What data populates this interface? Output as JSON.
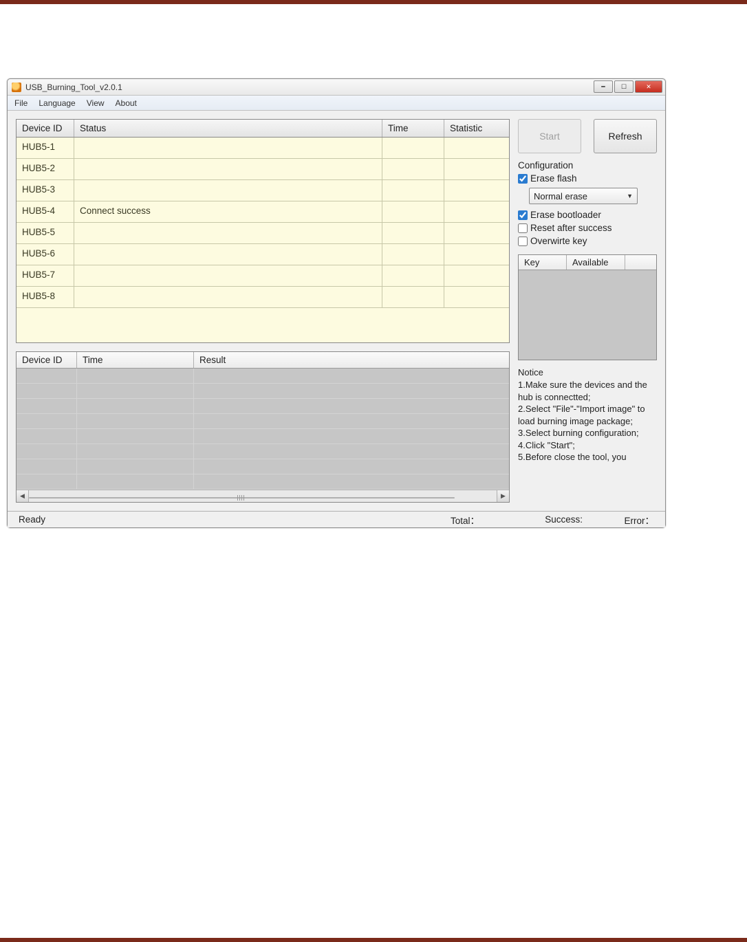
{
  "window": {
    "title": "USB_Burning_Tool_v2.0.1"
  },
  "menu": {
    "items": [
      "File",
      "Language",
      "View",
      "About"
    ]
  },
  "deviceTable": {
    "headers": {
      "id": "Device ID",
      "status": "Status",
      "time": "Time",
      "stat": "Statistic"
    },
    "rows": [
      {
        "id": "HUB5-1",
        "status": "",
        "time": "",
        "stat": ""
      },
      {
        "id": "HUB5-2",
        "status": "",
        "time": "",
        "stat": ""
      },
      {
        "id": "HUB5-3",
        "status": "",
        "time": "",
        "stat": ""
      },
      {
        "id": "HUB5-4",
        "status": "Connect success",
        "time": "",
        "stat": ""
      },
      {
        "id": "HUB5-5",
        "status": "",
        "time": "",
        "stat": ""
      },
      {
        "id": "HUB5-6",
        "status": "",
        "time": "",
        "stat": ""
      },
      {
        "id": "HUB5-7",
        "status": "",
        "time": "",
        "stat": ""
      },
      {
        "id": "HUB5-8",
        "status": "",
        "time": "",
        "stat": ""
      }
    ]
  },
  "resultTable": {
    "headers": {
      "id": "Device ID",
      "time": "Time",
      "result": "Result"
    }
  },
  "buttons": {
    "start": "Start",
    "refresh": "Refresh"
  },
  "config": {
    "legend": "Configuration",
    "eraseFlash": {
      "label": "Erase flash",
      "checked": true
    },
    "eraseMode": "Normal erase",
    "eraseBootloader": {
      "label": "Erase bootloader",
      "checked": true
    },
    "resetAfter": {
      "label": "Reset after success",
      "checked": false
    },
    "overwriteKey": {
      "label": "Overwirte key",
      "checked": false
    }
  },
  "keyTable": {
    "headers": {
      "key": "Key",
      "available": "Available"
    }
  },
  "notice": {
    "legend": "Notice",
    "lines": [
      "1.Make sure the devices and the hub is connectted;",
      "2.Select \"File\"-\"Import image\" to load burning image package;",
      "3.Select burning configuration;",
      "4.Click \"Start\";",
      "5.Before close the tool, you"
    ]
  },
  "status": {
    "ready": "Ready",
    "total": "Total：",
    "success": "Success:",
    "error": "Error："
  }
}
